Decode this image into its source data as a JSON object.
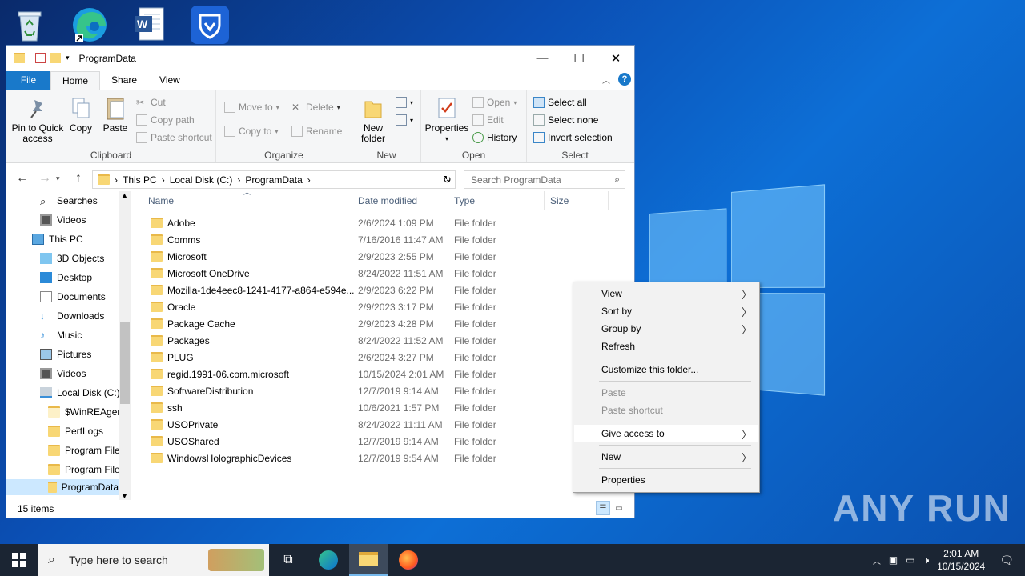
{
  "window": {
    "title": "ProgramData"
  },
  "ribbon": {
    "tabs": [
      "File",
      "Home",
      "Share",
      "View"
    ],
    "clipboard": {
      "pin": "Pin to Quick access",
      "copy": "Copy",
      "paste": "Paste",
      "cut": "Cut",
      "copy_path": "Copy path",
      "paste_shortcut": "Paste shortcut",
      "label": "Clipboard"
    },
    "organize": {
      "move_to": "Move to",
      "copy_to": "Copy to",
      "delete": "Delete",
      "rename": "Rename",
      "label": "Organize"
    },
    "new": {
      "new_folder": "New folder",
      "label": "New"
    },
    "open": {
      "properties": "Properties",
      "open": "Open",
      "edit": "Edit",
      "history": "History",
      "label": "Open"
    },
    "select": {
      "select_all": "Select all",
      "select_none": "Select none",
      "invert": "Invert selection",
      "label": "Select"
    }
  },
  "address": {
    "crumbs": [
      "This PC",
      "Local Disk (C:)",
      "ProgramData"
    ],
    "search_placeholder": "Search ProgramData"
  },
  "nav": {
    "items": [
      {
        "label": "Searches"
      },
      {
        "label": "Videos"
      },
      {
        "label": "This PC"
      },
      {
        "label": "3D Objects"
      },
      {
        "label": "Desktop"
      },
      {
        "label": "Documents"
      },
      {
        "label": "Downloads"
      },
      {
        "label": "Music"
      },
      {
        "label": "Pictures"
      },
      {
        "label": "Videos"
      },
      {
        "label": "Local Disk (C:)"
      },
      {
        "label": "$WinREAgent"
      },
      {
        "label": "PerfLogs"
      },
      {
        "label": "Program Files"
      },
      {
        "label": "Program Files"
      },
      {
        "label": "ProgramData"
      }
    ]
  },
  "columns": {
    "name": "Name",
    "date": "Date modified",
    "type": "Type",
    "size": "Size"
  },
  "files": [
    {
      "name": "Adobe",
      "date": "2/6/2024 1:09 PM",
      "type": "File folder"
    },
    {
      "name": "Comms",
      "date": "7/16/2016 11:47 AM",
      "type": "File folder"
    },
    {
      "name": "Microsoft",
      "date": "2/9/2023 2:55 PM",
      "type": "File folder"
    },
    {
      "name": "Microsoft OneDrive",
      "date": "8/24/2022 11:51 AM",
      "type": "File folder"
    },
    {
      "name": "Mozilla-1de4eec8-1241-4177-a864-e594e...",
      "date": "2/9/2023 6:22 PM",
      "type": "File folder"
    },
    {
      "name": "Oracle",
      "date": "2/9/2023 3:17 PM",
      "type": "File folder"
    },
    {
      "name": "Package Cache",
      "date": "2/9/2023 4:28 PM",
      "type": "File folder"
    },
    {
      "name": "Packages",
      "date": "8/24/2022 11:52 AM",
      "type": "File folder"
    },
    {
      "name": "PLUG",
      "date": "2/6/2024 3:27 PM",
      "type": "File folder"
    },
    {
      "name": "regid.1991-06.com.microsoft",
      "date": "10/15/2024 2:01 AM",
      "type": "File folder"
    },
    {
      "name": "SoftwareDistribution",
      "date": "12/7/2019 9:14 AM",
      "type": "File folder"
    },
    {
      "name": "ssh",
      "date": "10/6/2021 1:57 PM",
      "type": "File folder"
    },
    {
      "name": "USOPrivate",
      "date": "8/24/2022 11:11 AM",
      "type": "File folder"
    },
    {
      "name": "USOShared",
      "date": "12/7/2019 9:14 AM",
      "type": "File folder"
    },
    {
      "name": "WindowsHolographicDevices",
      "date": "12/7/2019 9:54 AM",
      "type": "File folder"
    }
  ],
  "status": {
    "count": "15 items"
  },
  "context_menu": {
    "view": "View",
    "sort_by": "Sort by",
    "group_by": "Group by",
    "refresh": "Refresh",
    "customize": "Customize this folder...",
    "paste": "Paste",
    "paste_shortcut": "Paste shortcut",
    "give_access": "Give access to",
    "new": "New",
    "properties": "Properties"
  },
  "taskbar": {
    "search_placeholder": "Type here to search",
    "time": "2:01 AM",
    "date": "10/15/2024"
  },
  "watermark": "ANY RUN",
  "colors": {
    "accent": "#1979ca",
    "selection": "#cce8ff",
    "taskbar": "#1b2533"
  }
}
